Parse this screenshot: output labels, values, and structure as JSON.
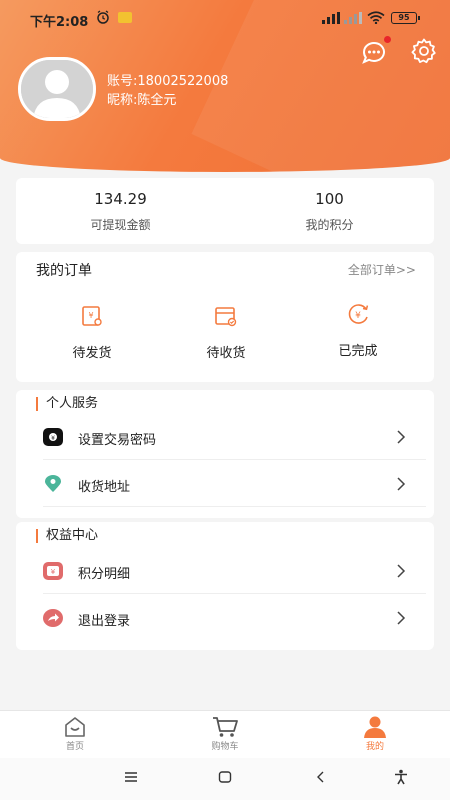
{
  "status_bar": {
    "time": "下午2:08",
    "battery": "95"
  },
  "user": {
    "account": "账号:18002522008",
    "nickname": "昵称:陈全元"
  },
  "balance": {
    "withdrawable_value": "134.29",
    "withdrawable_label": "可提现金额",
    "points_value": "100",
    "points_label": "我的积分"
  },
  "orders": {
    "title": "我的订单",
    "all_label": "全部订单>>",
    "items": [
      {
        "label": "待发货",
        "icon": "pending-shipment-icon"
      },
      {
        "label": "待收货",
        "icon": "pending-receipt-icon"
      },
      {
        "label": "已完成",
        "icon": "completed-icon"
      }
    ]
  },
  "personal_service": {
    "title": "个人服务",
    "items": [
      {
        "label": "设置交易密码",
        "icon": "password-icon"
      },
      {
        "label": "收货地址",
        "icon": "location-icon"
      }
    ]
  },
  "rights_center": {
    "title": "权益中心",
    "items": [
      {
        "label": "积分明细",
        "icon": "points-icon"
      },
      {
        "label": "退出登录",
        "icon": "logout-icon"
      }
    ]
  },
  "tabs": [
    {
      "label": "首页",
      "icon": "home-icon"
    },
    {
      "label": "购物车",
      "icon": "cart-icon"
    },
    {
      "label": "我的",
      "icon": "user-icon",
      "active": true
    }
  ],
  "colors": {
    "accent": "#f47a3e",
    "header_start": "#f59a5f",
    "header_end": "#f07035",
    "notification": "#e8262a"
  }
}
